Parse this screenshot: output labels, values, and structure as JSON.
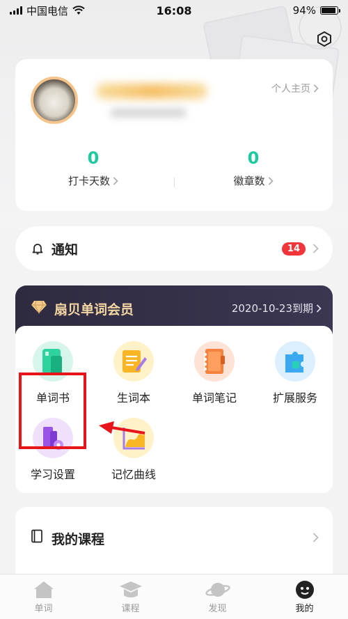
{
  "status_bar": {
    "carrier": "中国电信",
    "time": "16:08",
    "battery": "94%",
    "battery_level": 0.94
  },
  "profile": {
    "homepage_link": "个人主页",
    "stats": [
      {
        "value": "0",
        "label": "打卡天数"
      },
      {
        "value": "0",
        "label": "徽章数"
      }
    ]
  },
  "notification": {
    "title": "通知",
    "count": "14"
  },
  "membership": {
    "title": "扇贝单词会员",
    "expiry": "2020-10-23到期",
    "features": [
      {
        "label": "单词书",
        "icon": "book-icon"
      },
      {
        "label": "生词本",
        "icon": "notepad-pencil-icon"
      },
      {
        "label": "单词笔记",
        "icon": "notebook-icon"
      },
      {
        "label": "扩展服务",
        "icon": "puzzle-icon"
      },
      {
        "label": "学习设置",
        "icon": "study-settings-icon"
      },
      {
        "label": "记忆曲线",
        "icon": "memory-curve-icon"
      }
    ]
  },
  "courses": {
    "title": "我的课程"
  },
  "tabs": [
    {
      "label": "单词",
      "icon": "home-icon"
    },
    {
      "label": "课程",
      "icon": "graduation-cap-icon"
    },
    {
      "label": "发现",
      "icon": "planet-icon"
    },
    {
      "label": "我的",
      "icon": "profile-icon",
      "active": true
    }
  ],
  "colors": {
    "accent": "#1ec9a0",
    "badge": "#f2343b",
    "member_gold": "#f3d6a2",
    "member_bg": "#2e2a3f",
    "highlight": "#e8141b"
  }
}
